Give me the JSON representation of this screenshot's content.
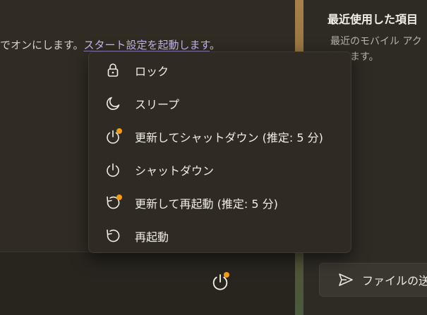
{
  "left_pane": {
    "hint_prefix": "でオンにします。",
    "hint_link": "スタート設定を起動します",
    "hint_suffix": "。"
  },
  "right_pane": {
    "title": "最近使用した項目",
    "desc_line1": "最近のモバイル アク",
    "desc_line2": "認します。",
    "send_button_label": "ファイルの送"
  },
  "power_menu": {
    "items": [
      {
        "label": "ロック",
        "icon": "lock-icon"
      },
      {
        "label": "スリープ",
        "icon": "sleep-icon"
      },
      {
        "label": "更新してシャットダウン (推定: 5 分)",
        "icon": "update-shutdown-icon"
      },
      {
        "label": "シャットダウン",
        "icon": "power-icon"
      },
      {
        "label": "更新して再起動 (推定: 5 分)",
        "icon": "update-restart-icon"
      },
      {
        "label": "再起動",
        "icon": "restart-icon"
      }
    ]
  },
  "colors": {
    "accent_badge": "#f29a1a",
    "link": "#c9b6f0"
  }
}
